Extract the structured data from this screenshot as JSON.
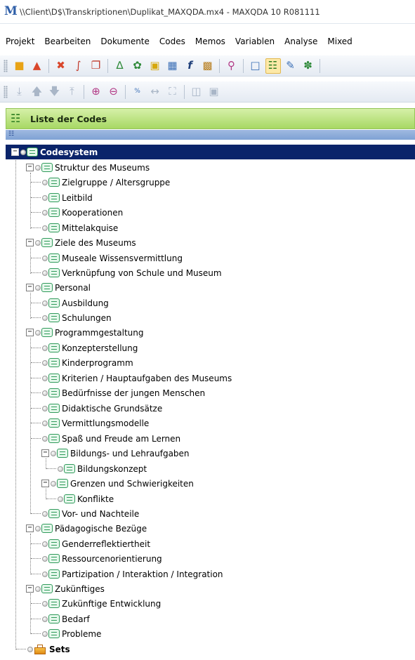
{
  "window": {
    "title": "\\\\Client\\D$\\Transkriptionen\\Duplikat_MAXQDA.mx4 - MAXQDA 10  R081111"
  },
  "menu": [
    "Projekt",
    "Bearbeiten",
    "Dokumente",
    "Codes",
    "Memos",
    "Variablen",
    "Analyse",
    "Mixed"
  ],
  "toolbar1": {
    "icons": [
      "open-folder-icon",
      "open-project-icon",
      "cut-icon",
      "link-icon",
      "copy-icon",
      "retrieve-icon",
      "activate-icon",
      "memo-icon",
      "table-icon",
      "function-icon",
      "book-icon",
      "search-icon",
      "window-icon",
      "code-system-icon",
      "edit-memo-icon",
      "share-icon"
    ],
    "active_icon": "code-system-icon"
  },
  "toolbar2": {
    "icons": [
      "first-icon",
      "up-icon",
      "down-icon",
      "last-icon",
      "zoom-in-icon",
      "zoom-out-icon",
      "zoom-100-icon",
      "fit-width-icon",
      "fit-page-icon",
      "split-icon",
      "frame-icon"
    ]
  },
  "panel": {
    "title": "Liste der Codes"
  },
  "tree": {
    "root": "Codesystem",
    "groups": [
      {
        "label": "Struktur des Museums",
        "children": [
          "Zielgruppe / Altersgruppe",
          "Leitbild",
          "Kooperationen",
          "Mittelakquise"
        ]
      },
      {
        "label": "Ziele des Museums",
        "children": [
          "Museale Wissensvermittlung",
          "Verknüpfung von Schule und Museum"
        ]
      },
      {
        "label": "Personal",
        "children": [
          "Ausbildung",
          "Schulungen"
        ]
      },
      {
        "label": "Programmgestaltung",
        "children": [
          "Konzepterstellung",
          "Kinderprogramm",
          "Kriterien / Hauptaufgaben des Museums",
          "Bedürfnisse der jungen Menschen",
          "Didaktische Grundsätze",
          "Vermittlungsmodelle",
          "Spaß und Freude am Lernen",
          "Bildungs- und Lehraufgaben",
          "Bildungskonzept",
          "Grenzen und Schwierigkeiten",
          "Konflikte",
          "Vor- und Nachteile"
        ]
      },
      {
        "label": "Pädagogische Bezüge",
        "children": [
          "Genderreflektiertheit",
          "Ressourcenorientierung",
          "Partizipation / Interaktion / Integration"
        ]
      },
      {
        "label": "Zukünftiges",
        "children": [
          "Zukünftige Entwicklung",
          "Bedarf",
          "Probleme"
        ]
      }
    ],
    "sets": "Sets"
  },
  "colors": {
    "selection": "#0a246a",
    "panel_header": "#a7d864",
    "code_icon": "#2f9a5a"
  }
}
